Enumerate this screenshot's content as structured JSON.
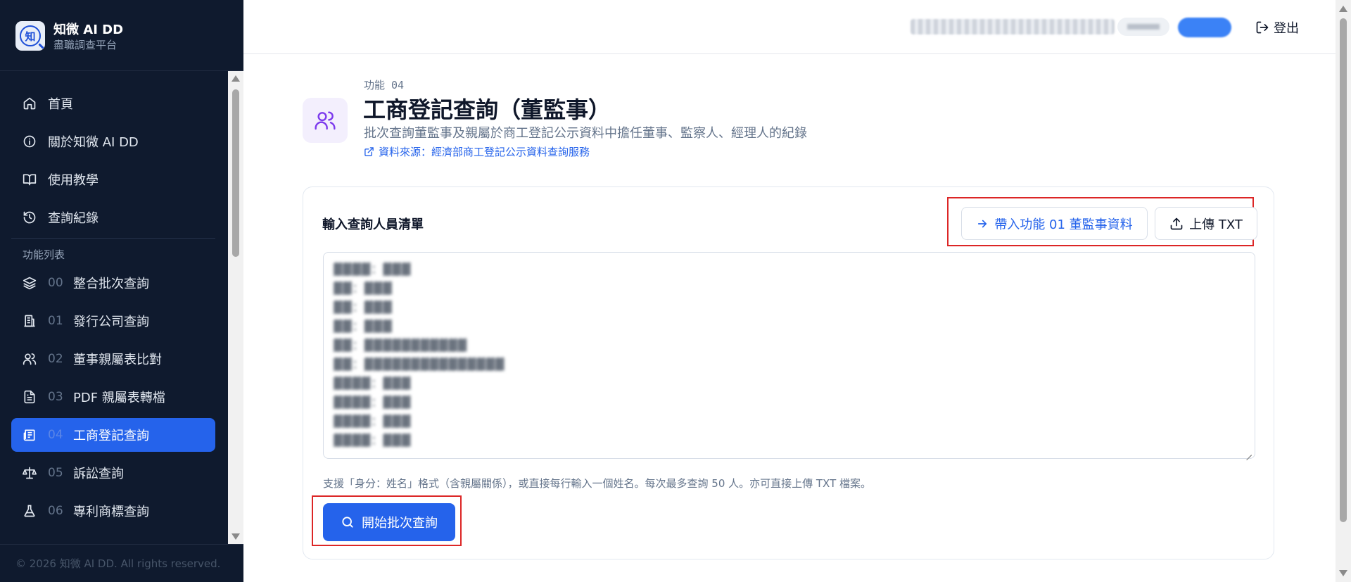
{
  "brand": {
    "logo_char": "知",
    "name": "知微 AI DD",
    "subtitle": "盡職調查平台"
  },
  "sidebar": {
    "items": [
      {
        "label": "首頁",
        "icon": "home-icon"
      },
      {
        "label": "關於知微 AI DD",
        "icon": "info-icon"
      },
      {
        "label": "使用教學",
        "icon": "book-icon"
      },
      {
        "label": "查詢紀錄",
        "icon": "history-icon"
      }
    ],
    "section_title": "功能列表",
    "features": [
      {
        "num": "00",
        "label": "整合批次查詢",
        "icon": "layers-icon"
      },
      {
        "num": "01",
        "label": "發行公司查詢",
        "icon": "building-icon"
      },
      {
        "num": "02",
        "label": "董事親屬表比對",
        "icon": "users-icon"
      },
      {
        "num": "03",
        "label": "PDF 親屬表轉檔",
        "icon": "file-text-icon"
      },
      {
        "num": "04",
        "label": "工商登記查詢",
        "icon": "newspaper-icon",
        "active": true
      },
      {
        "num": "05",
        "label": "訴訟查詢",
        "icon": "scale-icon"
      },
      {
        "num": "06",
        "label": "專利商標查詢",
        "icon": "flask-icon"
      }
    ],
    "footer": "© 2026 知微 AI DD. All rights reserved."
  },
  "header": {
    "logout_label": "登出"
  },
  "page": {
    "feature_label": "功能 04",
    "title": "工商登記查詢（董監事）",
    "description": "批次查詢董監事及親屬於商工登記公示資料中擔任董事、監察人、經理人的紀錄",
    "source_link": "資料來源：經濟部商工登記公示資料查詢服務"
  },
  "card": {
    "title": "輸入查詢人員清單",
    "import_button": "帶入功能 01 董監事資料",
    "upload_button": "上傳 TXT",
    "hint": "支援「身分：姓名」格式（含親屬關係），或直接每行輸入一個姓名。每次最多查詢 50 人。亦可直接上傳 TXT 檔案。",
    "start_button": "開始批次查詢"
  },
  "colors": {
    "sidebar_bg": "#0f1a2e",
    "accent": "#2563eb",
    "highlight_border": "#dc2626",
    "page_icon_bg": "#f3effd",
    "page_icon_color": "#7c3aed"
  }
}
